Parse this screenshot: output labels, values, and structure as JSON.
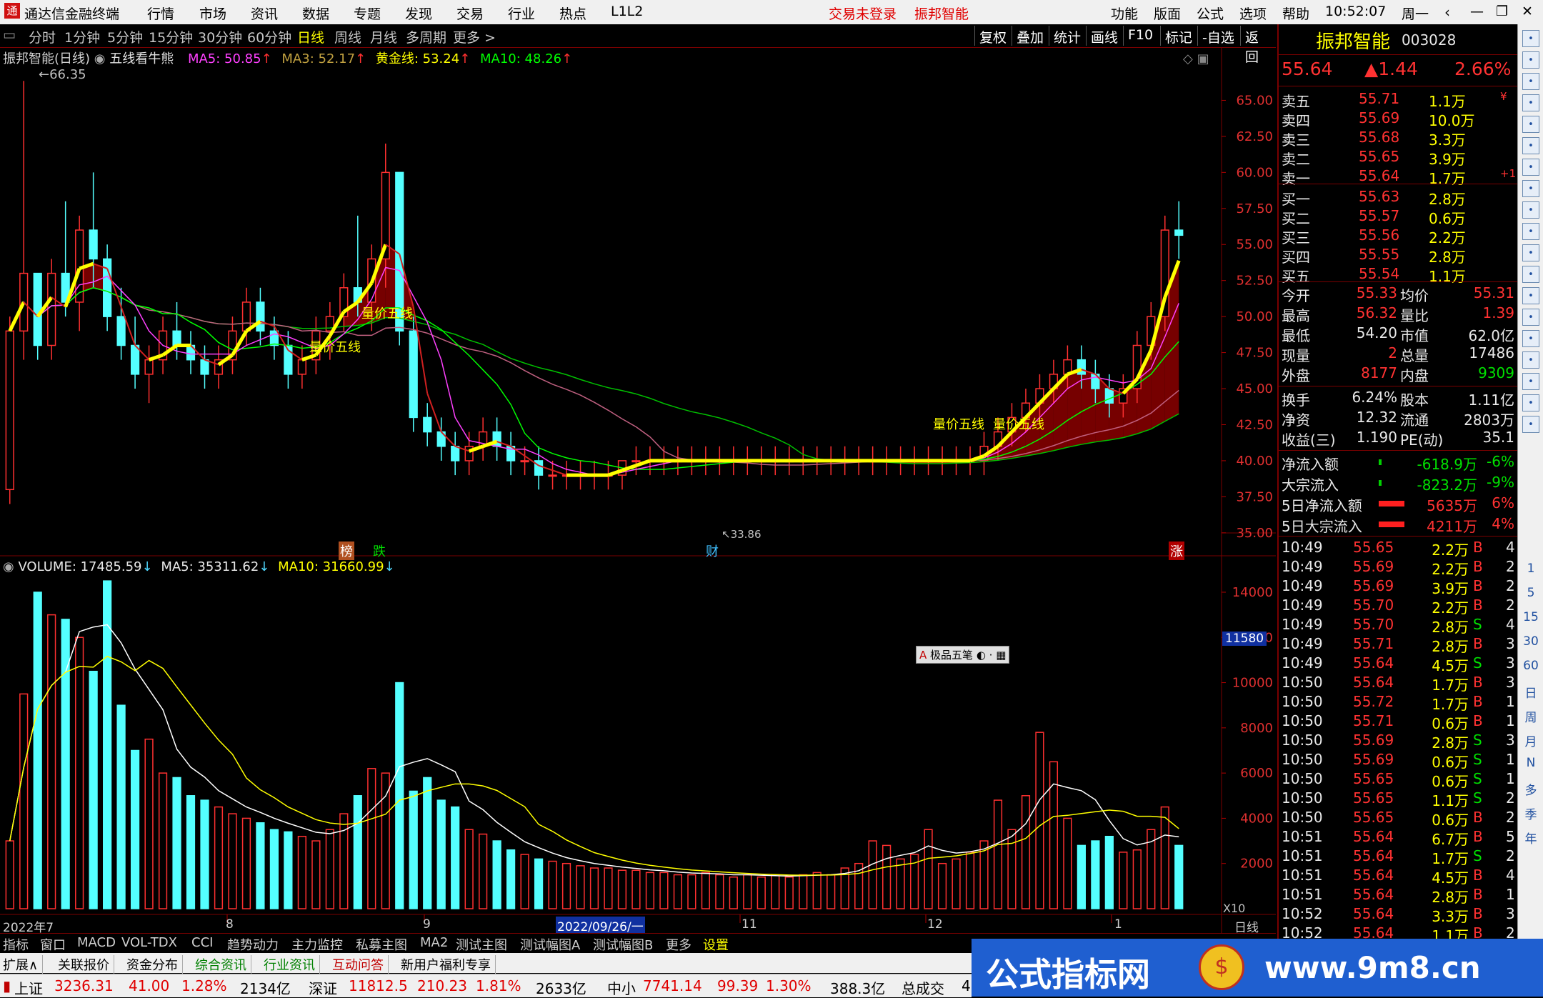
{
  "titlebar": {
    "app_title": "通达信金融终端",
    "menus": [
      "行情",
      "市场",
      "资讯",
      "数据",
      "专题",
      "发现",
      "交易",
      "行业",
      "热点",
      "L1L2"
    ],
    "trade_status": "交易未登录",
    "stock_name": "振邦智能",
    "right_menus": [
      "功能",
      "版面",
      "公式",
      "选项",
      "帮助"
    ],
    "clock": "10:52:07",
    "weekday": "周一"
  },
  "periodbar": {
    "periods": [
      "分时",
      "1分钟",
      "5分钟",
      "15分钟",
      "30分钟",
      "60分钟",
      "日线",
      "周线",
      "月线",
      "多周期",
      "更多 >"
    ],
    "active": "日线",
    "right_buttons": [
      "复权",
      "叠加",
      "统计",
      "画线",
      "F10",
      "标记",
      "-自选",
      "返回"
    ]
  },
  "main_chart": {
    "legend_title": "振邦智能(日线)",
    "formula_name": "五线看牛熊",
    "ma_items": [
      {
        "label": "MA5: 50.85",
        "color": "#ff40ff"
      },
      {
        "label": "MA3: 52.17",
        "color": "#c0a040"
      },
      {
        "label": "黄金线: 53.24",
        "color": "#ffff00"
      },
      {
        "label": "MA10: 48.26",
        "color": "#00ff00"
      }
    ],
    "high_label": "66.35",
    "low_label": "33.86",
    "annotations": [
      "量价五线",
      "量价五线",
      "量价五线",
      "量价五线"
    ],
    "event_tags": [
      {
        "text": "榜",
        "color": "#e08040"
      },
      {
        "text": "跌",
        "color": "#00e000"
      },
      {
        "text": "财",
        "color": "#40c0ff"
      },
      {
        "text": "涨",
        "color": "#ff3030"
      }
    ],
    "y_ticks": [
      "65.00",
      "62.50",
      "60.00",
      "57.50",
      "55.00",
      "52.50",
      "50.00",
      "47.50",
      "45.00",
      "42.50",
      "40.00",
      "37.50",
      "35.00"
    ]
  },
  "volume_chart": {
    "volume_label": "VOLUME: 17485.59",
    "ma5_label": "MA5: 35311.62",
    "ma10_label": "MA10: 31660.99",
    "y_ticks": [
      "14000",
      "12000",
      "10000",
      "8000",
      "6000",
      "4000",
      "2000"
    ],
    "cursor_value": "11580",
    "x10_label": "X10",
    "x_labels": [
      "2022年7",
      "8",
      "9",
      "2022/09/26/一",
      "11",
      "12",
      "1"
    ],
    "period_label": "日线",
    "tool_popup": "极品五笔"
  },
  "right_panel": {
    "name": "振邦智能",
    "code": "003028",
    "price": "55.64",
    "change": "▲1.44",
    "change_pct": "2.66%",
    "asks": [
      {
        "label": "卖五",
        "price": "55.71",
        "vol": "1.1万",
        "extra": "¥"
      },
      {
        "label": "卖四",
        "price": "55.69",
        "vol": "10.0万",
        "extra": ""
      },
      {
        "label": "卖三",
        "price": "55.68",
        "vol": "3.3万",
        "extra": ""
      },
      {
        "label": "卖二",
        "price": "55.65",
        "vol": "3.9万",
        "extra": ""
      },
      {
        "label": "卖一",
        "price": "55.64",
        "vol": "1.7万",
        "extra": "+1"
      }
    ],
    "bids": [
      {
        "label": "买一",
        "price": "55.63",
        "vol": "2.8万"
      },
      {
        "label": "买二",
        "price": "55.57",
        "vol": "0.6万"
      },
      {
        "label": "买三",
        "price": "55.56",
        "vol": "2.2万"
      },
      {
        "label": "买四",
        "price": "55.55",
        "vol": "2.8万"
      },
      {
        "label": "买五",
        "price": "55.54",
        "vol": "1.1万"
      }
    ],
    "quote_rows": [
      {
        "l1": "今开",
        "v1": "55.33",
        "c1": "red",
        "l2": "均价",
        "v2": "55.31",
        "c2": "red"
      },
      {
        "l1": "最高",
        "v1": "56.32",
        "c1": "red",
        "l2": "量比",
        "v2": "1.39",
        "c2": "red"
      },
      {
        "l1": "最低",
        "v1": "54.20",
        "c1": "wht",
        "l2": "市值",
        "v2": "62.0亿",
        "c2": "wht"
      },
      {
        "l1": "现量",
        "v1": "2",
        "c1": "red",
        "l2": "总量",
        "v2": "17486",
        "c2": "wht"
      },
      {
        "l1": "外盘",
        "v1": "8177",
        "c1": "red",
        "l2": "内盘",
        "v2": "9309",
        "c2": "grn"
      }
    ],
    "stats_rows": [
      {
        "l1": "换手",
        "v1": "6.24%",
        "l2": "股本",
        "v2": "1.11亿"
      },
      {
        "l1": "净资",
        "v1": "12.32",
        "l2": "流通",
        "v2": "2803万"
      },
      {
        "l1": "收益(三)",
        "v1": "1.190",
        "l2": "PE(动)",
        "v2": "35.1"
      }
    ],
    "flows": [
      {
        "label": "净流入额",
        "value": "-618.9万",
        "pct": "-6%",
        "color": "grn"
      },
      {
        "label": "大宗流入",
        "value": "-823.2万",
        "pct": "-9%",
        "color": "grn"
      },
      {
        "label": "5日净流入额",
        "value": "5635万",
        "pct": "6%",
        "color": "red"
      },
      {
        "label": "5日大宗流入",
        "value": "4211万",
        "pct": "4%",
        "color": "red"
      }
    ],
    "ticks": [
      {
        "t": "10:49",
        "p": "55.65",
        "v": "2.2万",
        "s": "B",
        "n": "4"
      },
      {
        "t": "10:49",
        "p": "55.69",
        "v": "2.2万",
        "s": "B",
        "n": "2"
      },
      {
        "t": "10:49",
        "p": "55.69",
        "v": "3.9万",
        "s": "B",
        "n": "2"
      },
      {
        "t": "10:49",
        "p": "55.70",
        "v": "2.2万",
        "s": "B",
        "n": "2"
      },
      {
        "t": "10:49",
        "p": "55.70",
        "v": "2.8万",
        "s": "S",
        "n": "4"
      },
      {
        "t": "10:49",
        "p": "55.71",
        "v": "2.8万",
        "s": "B",
        "n": "3"
      },
      {
        "t": "10:49",
        "p": "55.64",
        "v": "4.5万",
        "s": "S",
        "n": "3"
      },
      {
        "t": "10:50",
        "p": "55.64",
        "v": "1.7万",
        "s": "B",
        "n": "3"
      },
      {
        "t": "10:50",
        "p": "55.72",
        "v": "1.7万",
        "s": "B",
        "n": "1"
      },
      {
        "t": "10:50",
        "p": "55.71",
        "v": "0.6万",
        "s": "B",
        "n": "1"
      },
      {
        "t": "10:50",
        "p": "55.69",
        "v": "2.8万",
        "s": "S",
        "n": "3"
      },
      {
        "t": "10:50",
        "p": "55.69",
        "v": "0.6万",
        "s": "S",
        "n": "1"
      },
      {
        "t": "10:50",
        "p": "55.65",
        "v": "0.6万",
        "s": "S",
        "n": "1"
      },
      {
        "t": "10:50",
        "p": "55.65",
        "v": "1.1万",
        "s": "S",
        "n": "2"
      },
      {
        "t": "10:50",
        "p": "55.65",
        "v": "0.6万",
        "s": "B",
        "n": "2"
      },
      {
        "t": "10:51",
        "p": "55.64",
        "v": "6.7万",
        "s": "B",
        "n": "5"
      },
      {
        "t": "10:51",
        "p": "55.64",
        "v": "1.7万",
        "s": "S",
        "n": "2"
      },
      {
        "t": "10:51",
        "p": "55.64",
        "v": "4.5万",
        "s": "B",
        "n": "4"
      },
      {
        "t": "10:51",
        "p": "55.64",
        "v": "2.8万",
        "s": "B",
        "n": "1"
      },
      {
        "t": "10:52",
        "p": "55.64",
        "v": "3.3万",
        "s": "B",
        "n": "3"
      },
      {
        "t": "10:52",
        "p": "55.64",
        "v": "1.1万",
        "s": "B",
        "n": "2"
      }
    ]
  },
  "right_toolbar": {
    "chars": [
      "1",
      "5",
      "15",
      "30",
      "60",
      "日",
      "周",
      "月",
      "N",
      "多",
      "季",
      "年"
    ]
  },
  "bottom_tabs_1": [
    "指标",
    "窗口",
    "MACD",
    "VOL-TDX",
    "CCI",
    "趋势动力",
    "主力监控",
    "私募主图",
    "MA2",
    "测试主图",
    "测试幅图A",
    "测试幅图B",
    "更多",
    "设置"
  ],
  "bottom_tabs_2": [
    {
      "label": "扩展∧",
      "cls": ""
    },
    {
      "label": "关联报价",
      "cls": ""
    },
    {
      "label": "资金分布",
      "cls": ""
    },
    {
      "label": "综合资讯",
      "cls": "g"
    },
    {
      "label": "行业资讯",
      "cls": "g"
    },
    {
      "label": "互动问答",
      "cls": "r"
    },
    {
      "label": "新用户福利专享",
      "cls": ""
    }
  ],
  "statusbar": {
    "sh_label": "上证",
    "sh_index": "3236.31",
    "sh_chg": "41.00",
    "sh_pct": "1.28%",
    "sh_amt": "2134亿",
    "sz_label": "深证",
    "sz_index": "11812.5",
    "sz_chg": "210.23",
    "sz_pct": "1.81%",
    "sz_amt": "2633亿",
    "zx_label": "中小",
    "zx_index": "7741.14",
    "zx_chg": "99.39",
    "zx_pct": "1.30%",
    "zx_amt": "388.3亿",
    "total_label": "总成交",
    "total_val": "4"
  },
  "watermark": {
    "text": "公式指标网",
    "url": "www.9m8.cn"
  },
  "chart_data": {
    "type": "candlestick",
    "title": "振邦智能(日线)",
    "x_labels": [
      "2022年7",
      "8",
      "9",
      "2022/09/26/一",
      "11",
      "12",
      "1"
    ],
    "ylim": [
      33.86,
      66.35
    ],
    "candles": [
      [
        38,
        50,
        37,
        49
      ],
      [
        49,
        66.35,
        47,
        53
      ],
      [
        53,
        51,
        47,
        48
      ],
      [
        48,
        54,
        47,
        53
      ],
      [
        53,
        58,
        50,
        51
      ],
      [
        51,
        57,
        49,
        56
      ],
      [
        56,
        60,
        52,
        54
      ],
      [
        54,
        55,
        49,
        50
      ],
      [
        50,
        52,
        47,
        48
      ],
      [
        48,
        50,
        45,
        46
      ],
      [
        46,
        48,
        44,
        47
      ],
      [
        47,
        50,
        46,
        49
      ],
      [
        49,
        51,
        47,
        48
      ],
      [
        48,
        49,
        46,
        47
      ],
      [
        47,
        48,
        45,
        46
      ],
      [
        46,
        48,
        45,
        47
      ],
      [
        47,
        50,
        46,
        49
      ],
      [
        49,
        52,
        48,
        51
      ],
      [
        51,
        52,
        48,
        49
      ],
      [
        49,
        50,
        47,
        48
      ],
      [
        48,
        49,
        45,
        46
      ],
      [
        46,
        48,
        45,
        47
      ],
      [
        47,
        50,
        46,
        49
      ],
      [
        49,
        51,
        47,
        50
      ],
      [
        50,
        53,
        49,
        52
      ],
      [
        52,
        57,
        50,
        51
      ],
      [
        51,
        55,
        49,
        54
      ],
      [
        54,
        62,
        52,
        60
      ],
      [
        60,
        54,
        48,
        49
      ],
      [
        49,
        50,
        42,
        43
      ],
      [
        43,
        44,
        41,
        42
      ],
      [
        42,
        43,
        40,
        41
      ],
      [
        41,
        42,
        39,
        40
      ],
      [
        40,
        42,
        39,
        41
      ],
      [
        41,
        43,
        40,
        42
      ],
      [
        42,
        43,
        40,
        41
      ],
      [
        41,
        42,
        39,
        40
      ],
      [
        40,
        41,
        39,
        40
      ],
      [
        40,
        41,
        38,
        39
      ],
      [
        39,
        40,
        38,
        39
      ],
      [
        39,
        40,
        38,
        39
      ],
      [
        39,
        40,
        38,
        39
      ],
      [
        39,
        40,
        38,
        39
      ],
      [
        39,
        40,
        38,
        39
      ],
      [
        39,
        40,
        38,
        40
      ],
      [
        40,
        41,
        39,
        40
      ],
      [
        40,
        41,
        39,
        40
      ],
      [
        40,
        41,
        39,
        40
      ],
      [
        40,
        41,
        39,
        40
      ],
      [
        40,
        41,
        39,
        40
      ],
      [
        40,
        41,
        39,
        40
      ],
      [
        40,
        41,
        39,
        40
      ],
      [
        40,
        41,
        39,
        40
      ],
      [
        40,
        41,
        39,
        40
      ],
      [
        40,
        41,
        39,
        40
      ],
      [
        40,
        41,
        39,
        40
      ],
      [
        40,
        41,
        39,
        40
      ],
      [
        40,
        41,
        39,
        40
      ],
      [
        40,
        41,
        39,
        40
      ],
      [
        40,
        41,
        39,
        40
      ],
      [
        40,
        41,
        39,
        40
      ],
      [
        40,
        41,
        39,
        40
      ],
      [
        40,
        41,
        39,
        40
      ],
      [
        40,
        41,
        39,
        40
      ],
      [
        40,
        41,
        39,
        40
      ],
      [
        40,
        41,
        39,
        40
      ],
      [
        40,
        41,
        39,
        40
      ],
      [
        40,
        41,
        39,
        40
      ],
      [
        40,
        41,
        39,
        40
      ],
      [
        40,
        41,
        39,
        40
      ],
      [
        40,
        42,
        39,
        41
      ],
      [
        41,
        43,
        40,
        42
      ],
      [
        42,
        44,
        41,
        43
      ],
      [
        43,
        45,
        42,
        44
      ],
      [
        44,
        46,
        43,
        45
      ],
      [
        45,
        47,
        44,
        46
      ],
      [
        46,
        48,
        45,
        47
      ],
      [
        47,
        48,
        45,
        46
      ],
      [
        46,
        47,
        44,
        45
      ],
      [
        45,
        46,
        43,
        44
      ],
      [
        44,
        46,
        43,
        45
      ],
      [
        45,
        49,
        44,
        48
      ],
      [
        48,
        51,
        47,
        50
      ],
      [
        50,
        57,
        49,
        56
      ],
      [
        56,
        58,
        54,
        55.64
      ]
    ],
    "volume": [
      3000,
      9500,
      14000,
      13000,
      12800,
      12000,
      10500,
      14500,
      9000,
      7000,
      7500,
      6000,
      5800,
      5000,
      4800,
      4500,
      4200,
      4000,
      3800,
      3500,
      3400,
      3200,
      3000,
      3500,
      4200,
      5000,
      6200,
      6000,
      10000,
      5200,
      5800,
      4800,
      4500,
      3500,
      3300,
      3000,
      2600,
      2400,
      2200,
      2100,
      2000,
      1900,
      1800,
      1800,
      1700,
      1700,
      1600,
      1600,
      1500,
      1500,
      1600,
      1500,
      1400,
      1500,
      1400,
      1500,
      1400,
      1500,
      1600,
      1500,
      1800,
      2000,
      3000,
      2800,
      2200,
      2400,
      3500,
      2000,
      2200,
      2500,
      3000,
      4800,
      3500,
      5000,
      7800,
      6500,
      4000,
      2800,
      3000,
      3200,
      2500,
      2600,
      3500,
      4500,
      2800
    ]
  }
}
